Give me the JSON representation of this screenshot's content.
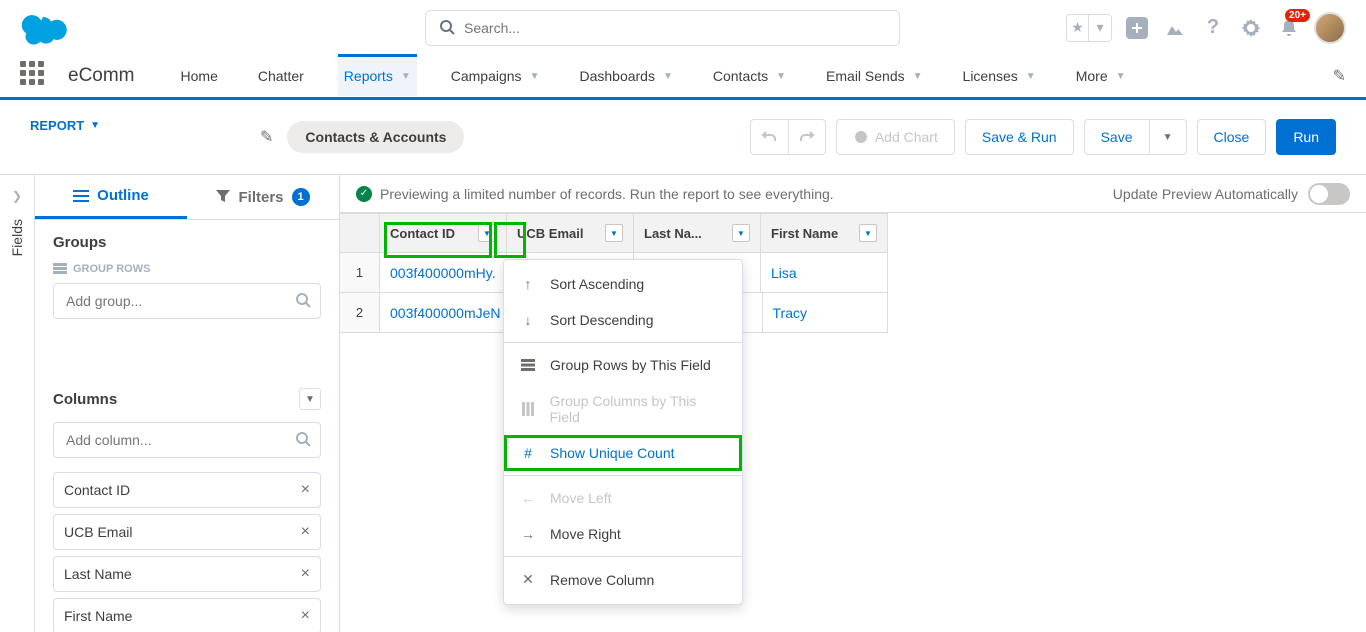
{
  "header": {
    "search_placeholder": "Search...",
    "notif_count": "20+"
  },
  "nav": {
    "app_name": "eComm",
    "items": [
      {
        "label": "Home",
        "chevron": false
      },
      {
        "label": "Chatter",
        "chevron": false
      },
      {
        "label": "Reports",
        "chevron": true,
        "active": true
      },
      {
        "label": "Campaigns",
        "chevron": true
      },
      {
        "label": "Dashboards",
        "chevron": true
      },
      {
        "label": "Contacts",
        "chevron": true
      },
      {
        "label": "Email Sends",
        "chevron": true
      },
      {
        "label": "Licenses",
        "chevron": true
      },
      {
        "label": "More",
        "chevron": true
      }
    ]
  },
  "sub": {
    "report_label": "REPORT",
    "title": "Contacts & Accounts",
    "add_chart": "Add Chart",
    "save_run": "Save & Run",
    "save": "Save",
    "close": "Close",
    "run": "Run"
  },
  "fields_rail": "Fields",
  "panel": {
    "outline": "Outline",
    "filters": "Filters",
    "filter_count": "1",
    "groups": "Groups",
    "group_rows": "GROUP ROWS",
    "add_group_placeholder": "Add group...",
    "columns": "Columns",
    "add_column_placeholder": "Add column...",
    "cols": [
      "Contact ID",
      "UCB Email",
      "Last Name",
      "First Name"
    ]
  },
  "preview": {
    "banner": "Previewing a limited number of records. Run the report to see everything.",
    "auto_label": "Update Preview Automatically",
    "headers": [
      "Contact ID",
      "UCB Email",
      "Last Na...",
      "First Name"
    ],
    "rows": [
      {
        "n": "1",
        "id": "003f400000mHy.",
        "first": "Lisa"
      },
      {
        "n": "2",
        "id": "003f400000mJeN",
        "first": "Tracy"
      }
    ]
  },
  "menu": {
    "sort_asc": "Sort Ascending",
    "sort_desc": "Sort Descending",
    "group_rows": "Group Rows by This Field",
    "group_cols": "Group Columns by This Field",
    "unique": "Show Unique Count",
    "move_left": "Move Left",
    "move_right": "Move Right",
    "remove": "Remove Column"
  }
}
